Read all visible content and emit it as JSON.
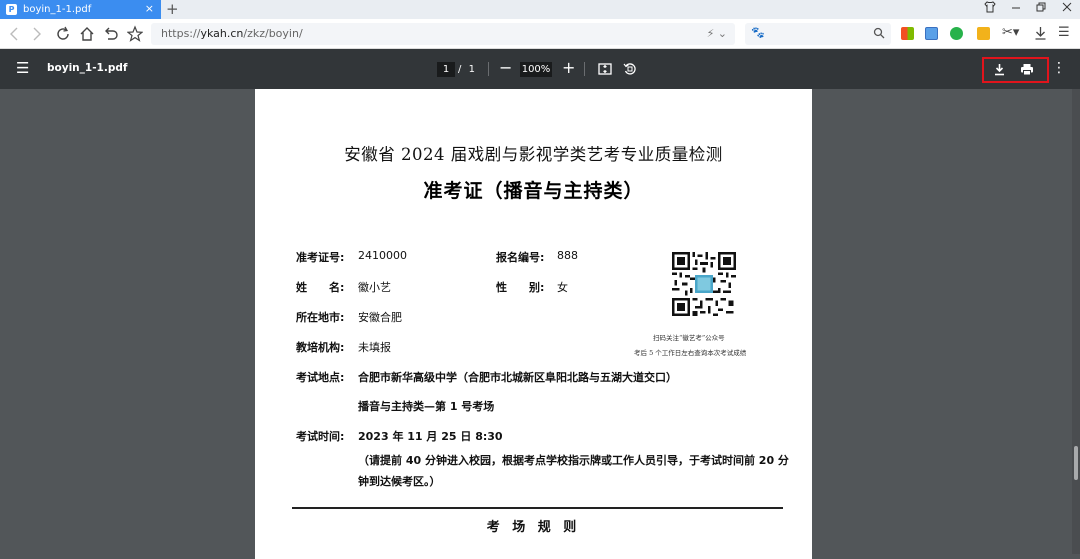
{
  "browser": {
    "tab_title": "boyin_1-1.pdf",
    "tab_favicon": "pdf",
    "tab_close": "×",
    "new_tab": "+",
    "url_scheme": "https://",
    "url_host": "ykah.cn",
    "url_path": "/zkz/boyin/"
  },
  "viewer": {
    "file_name": "boyin_1-1.pdf",
    "current_page": "1",
    "page_separator": "/",
    "total_pages": "1",
    "zoom": "100%",
    "zoom_out": "−",
    "zoom_in": "+"
  },
  "document": {
    "title": "安徽省 2024 届戏剧与影视学类艺考专业质量检测",
    "subtitle": "准考证（播音与主持类）",
    "fields": {
      "ticket_label": "准考证号:",
      "ticket_value": "2410000",
      "reg_label": "报名编号:",
      "reg_value": "888",
      "name_label": "姓　　名:",
      "name_value": "徽小艺",
      "gender_label": "性　　别:",
      "gender_value": "女",
      "location_label": "所在地市:",
      "location_value": "安徽合肥",
      "institution_label": "教培机构:",
      "institution_value": "未填报",
      "venue_label": "考试地点:",
      "venue_value": "合肥市新华高级中学（合肥市北城新区阜阳北路与五湖大道交口）",
      "room_value": "播音与主持类—第 1 号考场",
      "time_label": "考试时间:",
      "time_value": "2023 年 11 月 25 日 8:30",
      "note_line1": "（请提前 40 分钟进入校园，根据考点学校指示牌或工作人员引导，于考试时间前 20 分",
      "note_line2": "钟到达候考区。）"
    },
    "qr_caption1": "扫码关注“徽艺考”公众号",
    "qr_caption2": "考后 5 个工作日左右查询本次考试成绩",
    "rules_heading": "考 场 规 则"
  }
}
